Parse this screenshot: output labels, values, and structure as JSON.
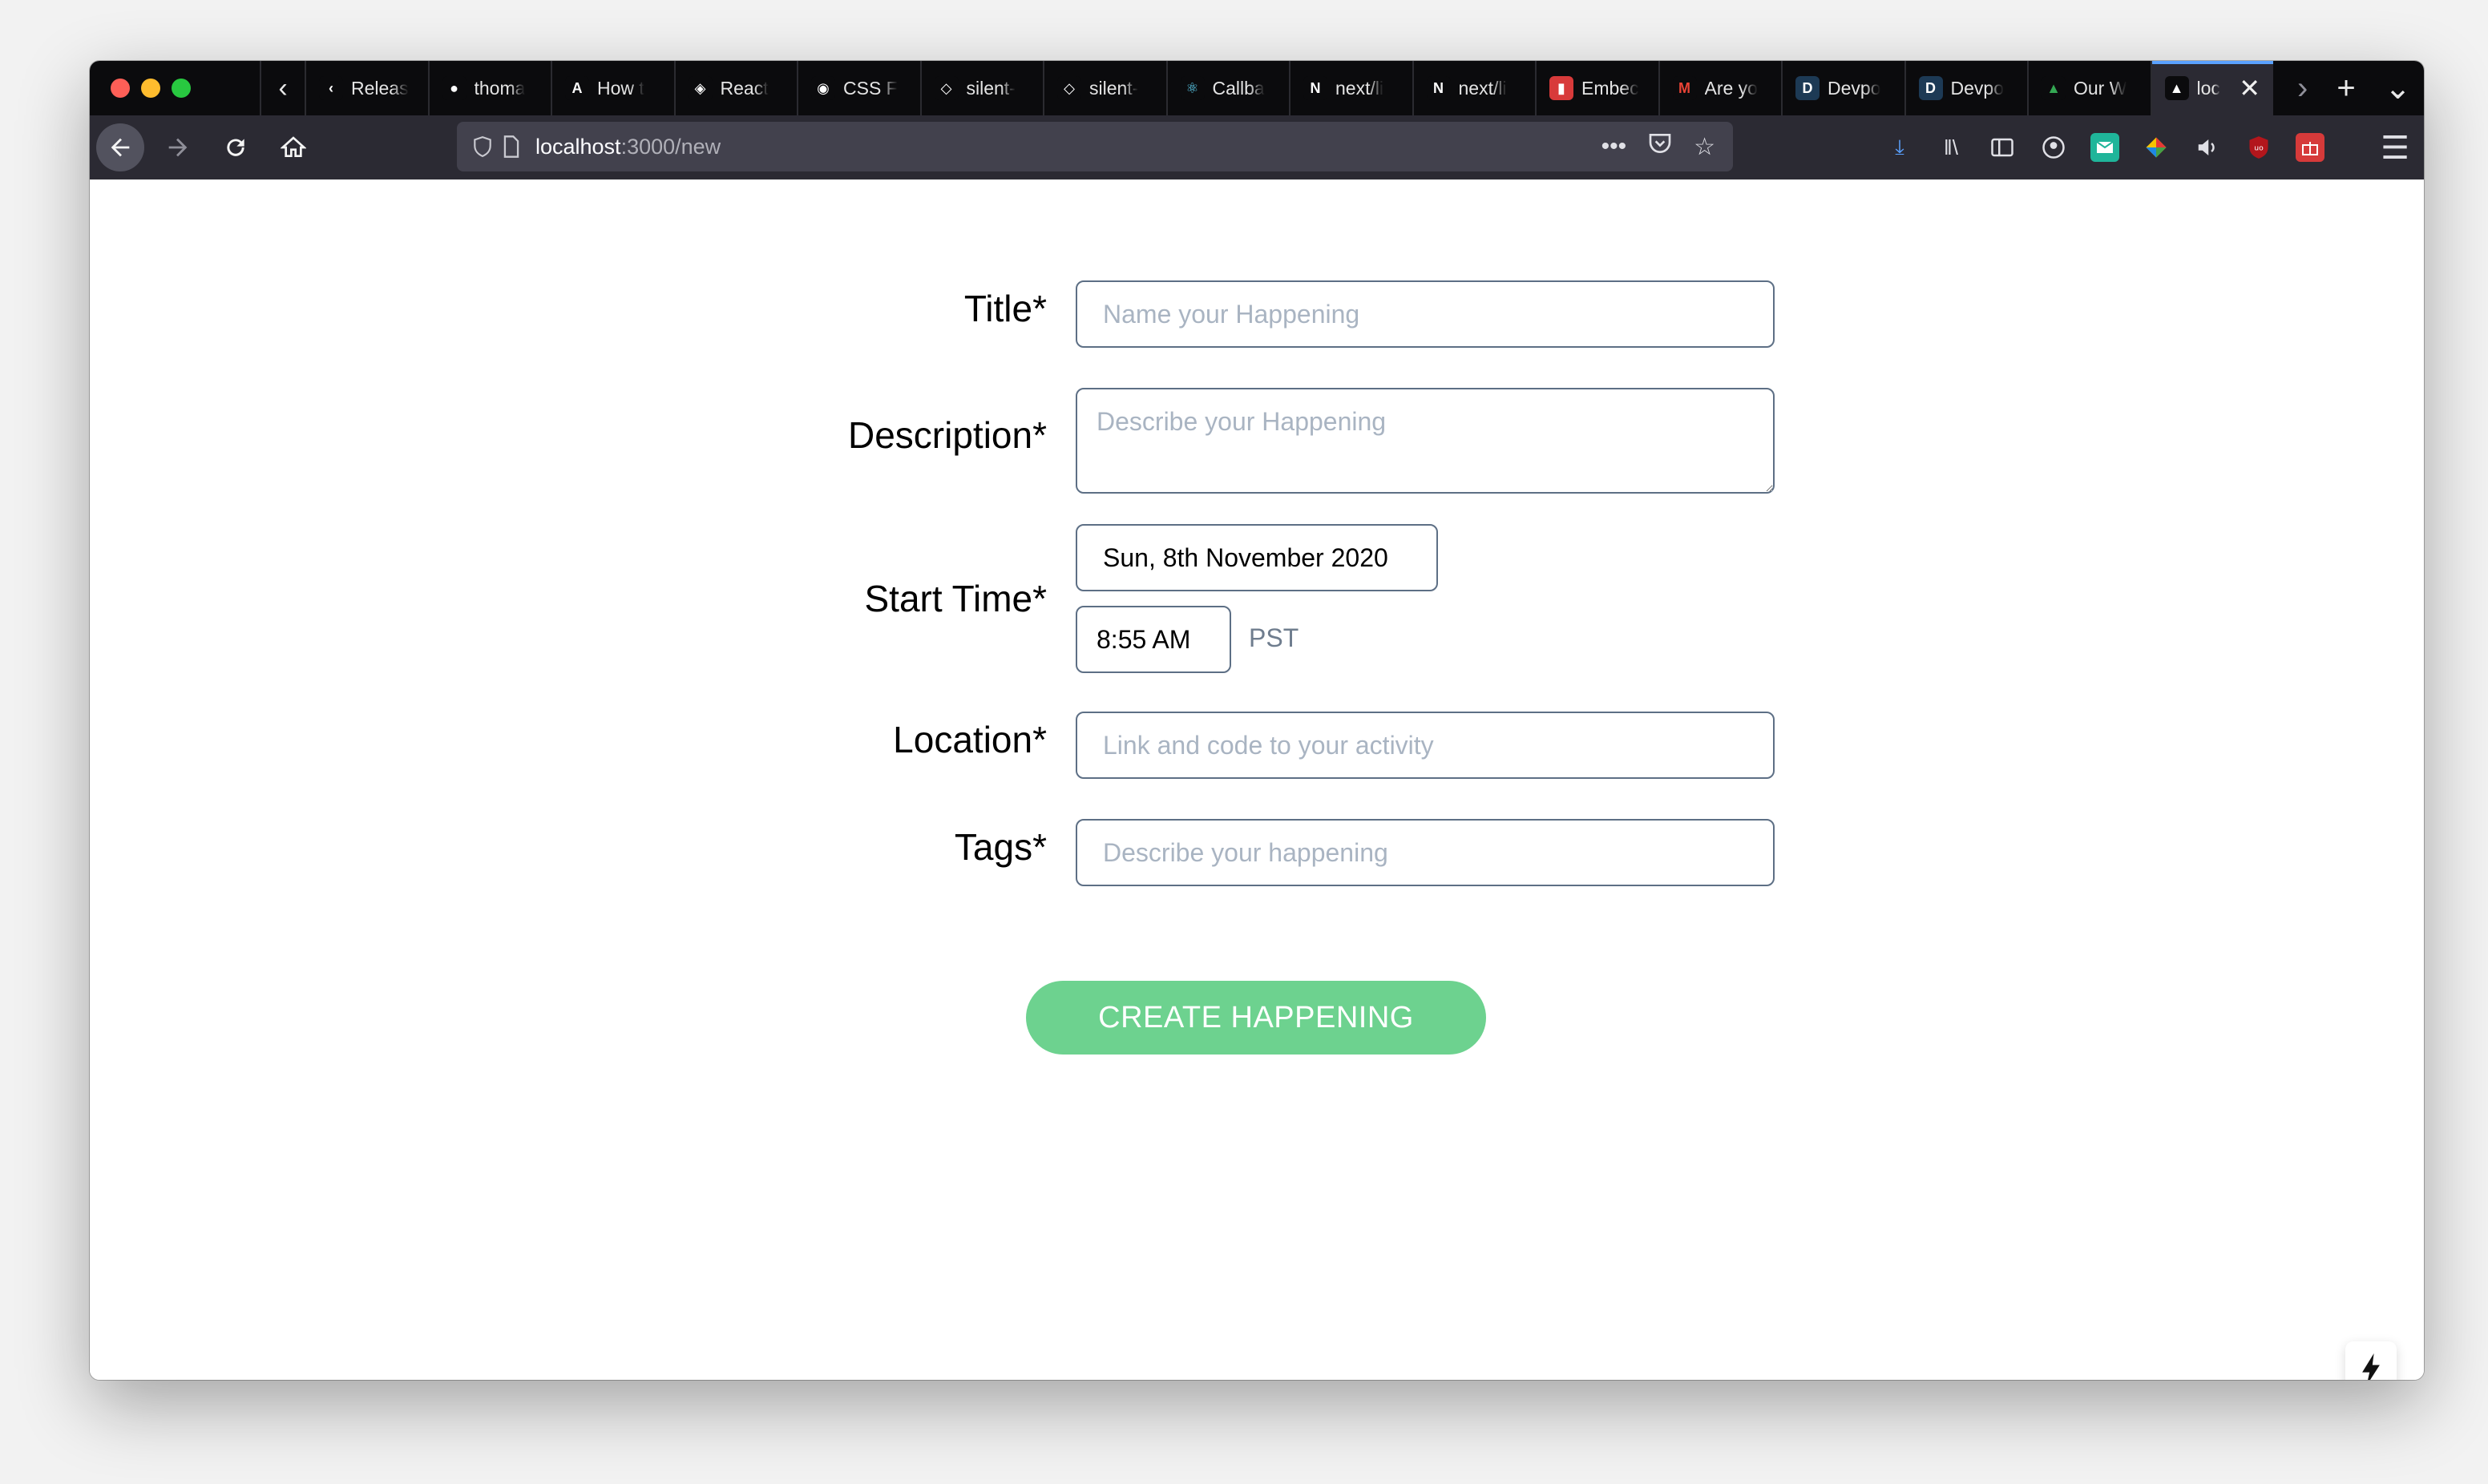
{
  "browser": {
    "tabs": [
      {
        "label": "Releas",
        "icon": "chevron-left-icon",
        "fav_bg": "#0b0b0d"
      },
      {
        "label": "thoma",
        "icon": "github-icon",
        "fav_bg": "#0b0b0d"
      },
      {
        "label": "How t",
        "icon": "angular-icon",
        "fav_bg": "#0b0b0d"
      },
      {
        "label": "React",
        "icon": "codesandbox-icon",
        "fav_bg": "#0b0b0d"
      },
      {
        "label": "CSS F",
        "icon": "css-icon",
        "fav_bg": "#0b0b0d"
      },
      {
        "label": "silent-",
        "icon": "package-icon",
        "fav_bg": "#0b0b0d"
      },
      {
        "label": "silent-",
        "icon": "package-icon",
        "fav_bg": "#0b0b0d"
      },
      {
        "label": "Callba",
        "icon": "react-icon",
        "fav_bg": "#0b0b0d"
      },
      {
        "label": "next/li",
        "icon": "next-icon",
        "fav_bg": "#0b0b0d"
      },
      {
        "label": "next/li",
        "icon": "next-icon",
        "fav_bg": "#0b0b0d"
      },
      {
        "label": "Embec",
        "icon": "trello-icon",
        "fav_bg": "#d83a3a"
      },
      {
        "label": "Are yo",
        "icon": "gmail-icon",
        "fav_bg": "#0b0b0d"
      },
      {
        "label": "Devpo",
        "icon": "devpost-icon",
        "fav_bg": "#1d3a55"
      },
      {
        "label": "Devpo",
        "icon": "devpost-icon",
        "fav_bg": "#1d3a55"
      },
      {
        "label": "Our W",
        "icon": "google-drive-icon",
        "fav_bg": "#0b0b0d"
      },
      {
        "label": "loc",
        "icon": "vercel-icon",
        "fav_bg": "#0b0b0d",
        "active": true
      }
    ],
    "url_host": "localhost",
    "url_path": ":3000/new",
    "tab_close_glyph": "✕",
    "new_tab_glyph": "+",
    "list_tabs_glyph": "⌄"
  },
  "form": {
    "title_label": "Title*",
    "title_placeholder": "Name your Happening",
    "description_label": "Description*",
    "description_placeholder": "Describe your Happening",
    "start_time_label": "Start Time*",
    "start_date_value": "Sun, 8th November 2020",
    "start_time_value": "8:55 AM",
    "timezone": "PST",
    "location_label": "Location*",
    "location_placeholder": "Link and code to your activity",
    "tags_label": "Tags*",
    "tags_placeholder": "Describe your happening",
    "submit_label": "CREATE HAPPENING"
  },
  "colors": {
    "accent_green": "#6dd28f",
    "input_border": "#5d6f85",
    "active_tab_indicator": "#5aa1ff"
  }
}
